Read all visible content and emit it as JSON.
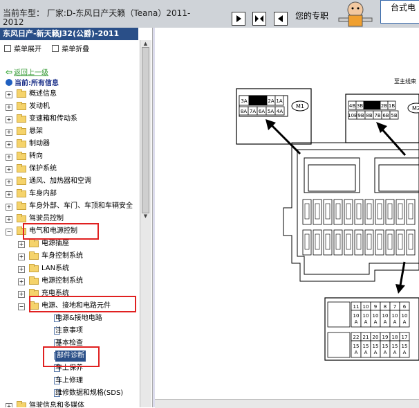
{
  "topbar": {
    "title": "当前车型： 厂家:D-东风日产天籁（Teana）2011-2012",
    "text": "您的专职",
    "label_box": "台式电"
  },
  "left": {
    "car_title": "东风日产-新天籁J32(公爵)-2011",
    "expand_label": "菜单展开",
    "collapse_label": "菜单折叠",
    "back_label": "返回上一级",
    "current_label": "当前:所有信息"
  },
  "tree": {
    "items": [
      {
        "label": "概述信息",
        "type": "folder",
        "level": 0,
        "expanded": false
      },
      {
        "label": "发动机",
        "type": "folder",
        "level": 0,
        "expanded": false
      },
      {
        "label": "变速箱和传动系",
        "type": "folder",
        "level": 0,
        "expanded": false
      },
      {
        "label": "悬架",
        "type": "folder",
        "level": 0,
        "expanded": false
      },
      {
        "label": "制动器",
        "type": "folder",
        "level": 0,
        "expanded": false
      },
      {
        "label": "转向",
        "type": "folder",
        "level": 0,
        "expanded": false
      },
      {
        "label": "保护系统",
        "type": "folder",
        "level": 0,
        "expanded": false
      },
      {
        "label": "通风、加热器和空调",
        "type": "folder",
        "level": 0,
        "expanded": false
      },
      {
        "label": "车身内部",
        "type": "folder",
        "level": 0,
        "expanded": false
      },
      {
        "label": "车身外部、车门、车顶和车辆安全",
        "type": "folder",
        "level": 0,
        "expanded": false
      },
      {
        "label": "驾驶员控制",
        "type": "folder",
        "level": 0,
        "expanded": false
      },
      {
        "label": "电气和电源控制",
        "type": "folder",
        "level": 0,
        "expanded": true
      },
      {
        "label": "电源插座",
        "type": "folder",
        "level": 1,
        "expanded": false
      },
      {
        "label": "车身控制系统",
        "type": "folder",
        "level": 1,
        "expanded": false
      },
      {
        "label": "LAN系统",
        "type": "folder",
        "level": 1,
        "expanded": false
      },
      {
        "label": "电源控制系统",
        "type": "folder",
        "level": 1,
        "expanded": false
      },
      {
        "label": "充电系统",
        "type": "folder",
        "level": 1,
        "expanded": false
      },
      {
        "label": "电源、接地和电路元件",
        "type": "folder",
        "level": 1,
        "expanded": true
      },
      {
        "label": "电源&接地电路",
        "type": "doc",
        "level": 2
      },
      {
        "label": "注意事项",
        "type": "doc",
        "level": 2
      },
      {
        "label": "基本检查",
        "type": "doc",
        "level": 2
      },
      {
        "label": "部件诊断",
        "type": "doc",
        "level": 2,
        "selected": true
      },
      {
        "label": "车上保养",
        "type": "doc",
        "level": 2
      },
      {
        "label": "车上修理",
        "type": "doc",
        "level": 2
      },
      {
        "label": "维修数据和规格(SDS)",
        "type": "doc",
        "level": 2
      },
      {
        "label": "驾驶信息和多媒体",
        "type": "folder",
        "level": 0,
        "expanded": false
      }
    ]
  },
  "diagram": {
    "header_label": "至主线束",
    "top_left_block": {
      "row1": [
        "3A",
        "",
        "2A",
        "1A"
      ],
      "row2": [
        "8A",
        "7A",
        "6A",
        "5A",
        "4A"
      ],
      "connector": "M1"
    },
    "top_right_block": {
      "row1": [
        "4B",
        "3B",
        "",
        "2B",
        "1B"
      ],
      "row2": [
        "10B",
        "9B",
        "8B",
        "7B",
        "6B",
        "5B"
      ],
      "connector": "M2"
    },
    "fuse_row1_numbers": [
      "11",
      "10",
      "9",
      "8",
      "7",
      "6"
    ],
    "fuse_row1_ratings": [
      "10\nA",
      "10\nA",
      "10\nA",
      "10\nA",
      "10\nA",
      "10\nA"
    ],
    "fuse_row2_numbers": [
      "22",
      "21",
      "20",
      "19",
      "18",
      "17"
    ],
    "fuse_row2_ratings": [
      "15\nA",
      "15\nA",
      "15\nA",
      "15\nA",
      "15\nA",
      "15\nA"
    ]
  }
}
